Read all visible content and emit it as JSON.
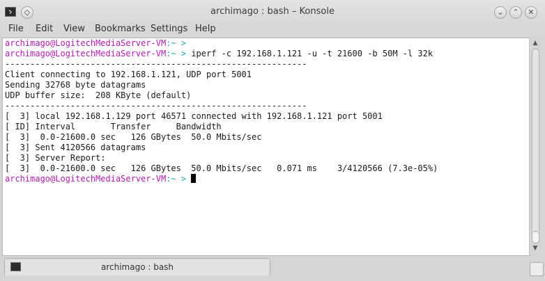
{
  "window": {
    "title": "archimago : bash – Konsole",
    "pin_icon": "pin-icon",
    "min_icon": "minimize-icon",
    "max_icon": "maximize-icon",
    "close_icon": "close-icon"
  },
  "menu": {
    "items": [
      "File",
      "Edit",
      "View",
      "Bookmarks",
      "Settings",
      "Help"
    ]
  },
  "terminal": {
    "prompt_user": "archimago@LogitechMediaServer-VM",
    "prompt_path": ":~ >",
    "command": "iperf -c 192.168.1.121 -u -t 21600 -b 50M -l 32k",
    "lines": [
      "------------------------------------------------------------",
      "Client connecting to 192.168.1.121, UDP port 5001",
      "Sending 32768 byte datagrams",
      "UDP buffer size:  208 KByte (default)",
      "------------------------------------------------------------",
      "[  3] local 192.168.1.129 port 46571 connected with 192.168.1.121 port 5001",
      "[ ID] Interval       Transfer     Bandwidth",
      "[  3]  0.0-21600.0 sec   126 GBytes  50.0 Mbits/sec",
      "[  3] Sent 4120566 datagrams",
      "[  3] Server Report:",
      "[  3]  0.0-21600.0 sec   126 GBytes  50.0 Mbits/sec   0.071 ms    3/4120566 (7.3e-05%)"
    ]
  },
  "tabs": [
    {
      "label": "archimago : bash"
    }
  ]
}
